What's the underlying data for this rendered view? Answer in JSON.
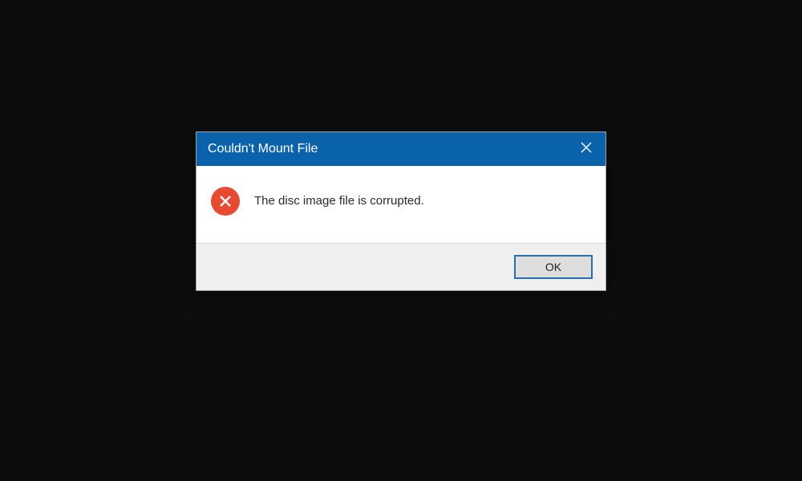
{
  "dialog": {
    "title": "Couldn't Mount File",
    "message": "The disc image file is corrupted.",
    "ok_label": "OK"
  }
}
